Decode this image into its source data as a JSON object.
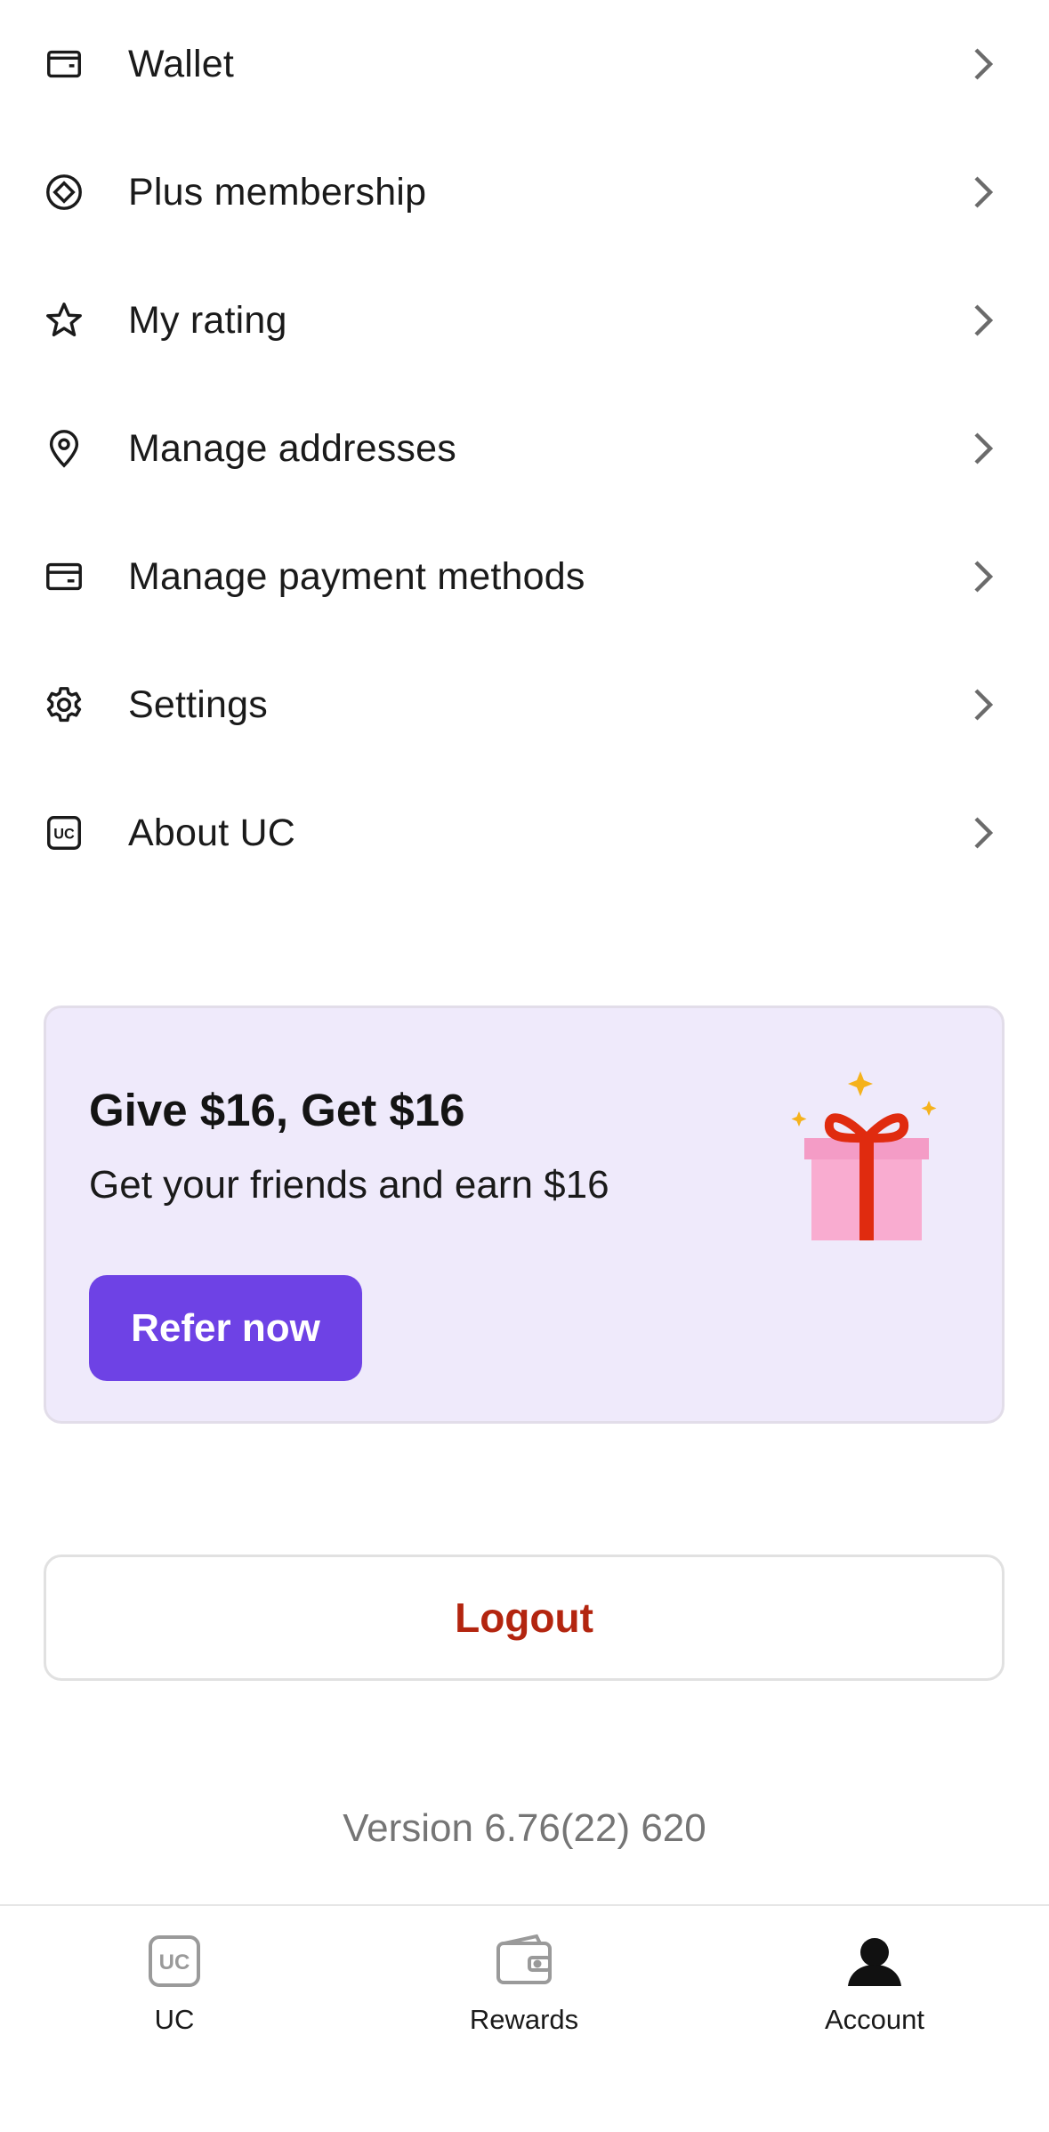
{
  "menu": {
    "items": [
      {
        "label": "Wallet",
        "icon": "wallet-icon"
      },
      {
        "label": "Plus membership",
        "icon": "plus-membership-icon"
      },
      {
        "label": "My rating",
        "icon": "star-icon"
      },
      {
        "label": "Manage addresses",
        "icon": "location-pin-icon"
      },
      {
        "label": "Manage payment methods",
        "icon": "card-icon"
      },
      {
        "label": "Settings",
        "icon": "gear-icon"
      },
      {
        "label": "About UC",
        "icon": "uc-logo-icon"
      }
    ],
    "uc_icon_text": "UC"
  },
  "promo": {
    "title": "Give $16, Get $16",
    "subtitle": "Get your friends and earn $16",
    "button_label": "Refer now",
    "illustration": "gift-icon"
  },
  "logout": {
    "label": "Logout"
  },
  "version": {
    "text": "Version 6.76(22) 620"
  },
  "bottom_nav": {
    "tabs": [
      {
        "label": "UC",
        "icon": "uc-logo-icon",
        "active": false
      },
      {
        "label": "Rewards",
        "icon": "wallet-icon",
        "active": false
      },
      {
        "label": "Account",
        "icon": "user-icon",
        "active": true
      }
    ]
  },
  "colors": {
    "accent": "#6e42e5",
    "promo_bg": "#efeafb",
    "logout_text": "#b3250f",
    "muted_text": "#757575",
    "gift_box": "#f9acd0",
    "gift_ribbon": "#e02b0f",
    "sparkle": "#f5b21c"
  }
}
